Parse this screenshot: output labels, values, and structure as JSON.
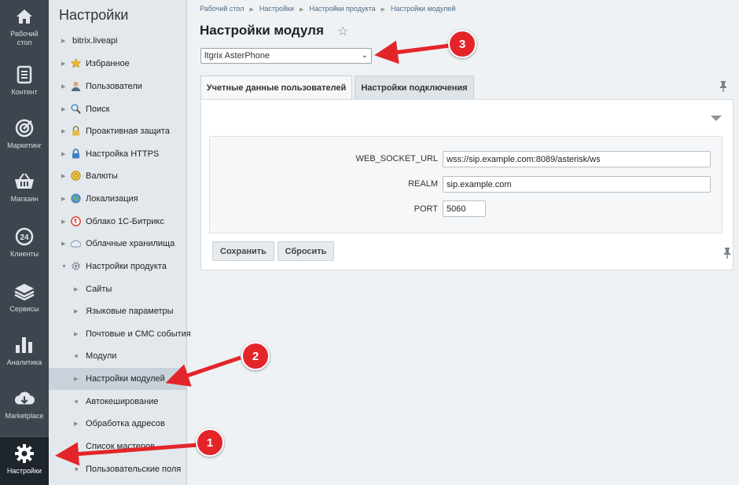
{
  "iconbar": {
    "items": [
      {
        "label": "Рабочий стол",
        "icon": "home-icon"
      },
      {
        "label": "Контент",
        "icon": "document-icon"
      },
      {
        "label": "Маркетинг",
        "icon": "target-icon"
      },
      {
        "label": "Магазин",
        "icon": "basket-icon"
      },
      {
        "label": "Клиенты",
        "icon": "clock-24-icon"
      },
      {
        "label": "Сервисы",
        "icon": "layers-icon"
      },
      {
        "label": "Аналитика",
        "icon": "bar-chart-icon"
      },
      {
        "label": "Marketplace",
        "icon": "cloud-download-icon"
      },
      {
        "label": "Настройки",
        "icon": "gear-icon"
      }
    ]
  },
  "tree": {
    "title": "Настройки",
    "items": [
      {
        "label": "bitrix.liveapi",
        "icon": "none"
      },
      {
        "label": "Избранное",
        "icon": "star-icon"
      },
      {
        "label": "Пользователи",
        "icon": "user-icon"
      },
      {
        "label": "Поиск",
        "icon": "search-icon"
      },
      {
        "label": "Проактивная защита",
        "icon": "lock-icon"
      },
      {
        "label": "Настройка HTTPS",
        "icon": "https-lock-icon"
      },
      {
        "label": "Валюты",
        "icon": "coin-icon"
      },
      {
        "label": "Локализация",
        "icon": "globe-icon"
      },
      {
        "label": "Облако 1С-Битрикс",
        "icon": "cloud-1c-icon"
      },
      {
        "label": "Облачные хранилища",
        "icon": "cloud-storage-icon"
      },
      {
        "label": "Настройки продукта",
        "icon": "settings-icon"
      },
      {
        "label": "Сайты",
        "icon": "none"
      },
      {
        "label": "Языковые параметры",
        "icon": "none"
      },
      {
        "label": "Почтовые и СМС события",
        "icon": "none"
      },
      {
        "label": "Модули",
        "icon": "none"
      },
      {
        "label": "Настройки модулей",
        "icon": "none"
      },
      {
        "label": "Автокеширование",
        "icon": "none"
      },
      {
        "label": "Обработка адресов",
        "icon": "none"
      },
      {
        "label": "Список мастеров",
        "icon": "none"
      },
      {
        "label": "Пользовательские поля",
        "icon": "none"
      }
    ]
  },
  "breadcrumb": [
    "Рабочий стол",
    "Настройки",
    "Настройки продукта",
    "Настройки модулей"
  ],
  "page": {
    "title": "Настройки модуля",
    "module_select": "ltgrix AsterPhone"
  },
  "tabs": [
    "Учетные данные пользователей",
    "Настройки подключения"
  ],
  "form": {
    "fields": [
      {
        "label": "WEB_SOCKET_URL",
        "value": "wss://sip.example.com:8089/asterisk/ws"
      },
      {
        "label": "REALM",
        "value": "sip.example.com"
      },
      {
        "label": "PORT",
        "value": "5060"
      }
    ],
    "save_label": "Сохранить",
    "reset_label": "Сбросить"
  },
  "annotations": [
    "1",
    "2",
    "3"
  ],
  "colors": {
    "annotation_red": "#e3252a",
    "sidebar_dark": "#3d464e",
    "tree_bg": "#e3e8ec"
  }
}
